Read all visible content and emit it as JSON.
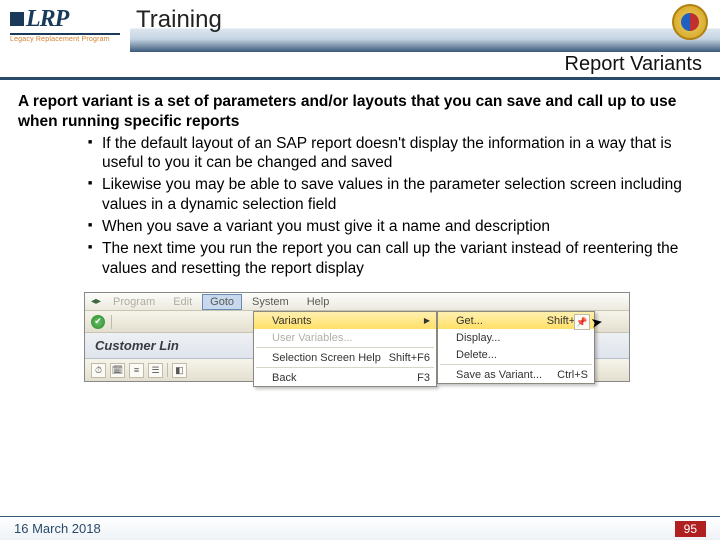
{
  "header": {
    "logo_text": "LRP",
    "logo_sub": "Legacy Replacement Program",
    "title": "Training"
  },
  "sub_header": {
    "title": "Report Variants"
  },
  "body": {
    "lead": "A report variant is a set of parameters and/or layouts that you can save and call up to use when running specific reports",
    "bullets": [
      "If the default layout of an SAP report doesn't display the information in a way that is useful to you it can be changed and saved",
      "Likewise you may be able to save values in the parameter selection screen including values in a dynamic selection field",
      "When you save a variant you must give it a name and description",
      "The next time you run the report you can call up the variant instead of reentering the values and resetting the report display"
    ]
  },
  "sap": {
    "menubar": {
      "program": "Program",
      "edit": "Edit",
      "goto": "Goto",
      "system": "System",
      "help": "Help"
    },
    "subtitle_row": "Customer Lin",
    "goto_menu": {
      "variants": {
        "label": "Variants"
      },
      "user_variables": {
        "label": "User Variables..."
      },
      "selection_screen_help": {
        "label": "Selection Screen Help",
        "shortcut": "Shift+F6"
      },
      "back": {
        "label": "Back",
        "shortcut": "F3"
      }
    },
    "variants_submenu": {
      "get": {
        "label": "Get...",
        "shortcut": "Shift+F5"
      },
      "display": {
        "label": "Display..."
      },
      "delete": {
        "label": "Delete..."
      },
      "save_as": {
        "label": "Save as Variant...",
        "shortcut": "Ctrl+S"
      }
    }
  },
  "footer": {
    "date": "16 March 2018",
    "page": "95"
  }
}
